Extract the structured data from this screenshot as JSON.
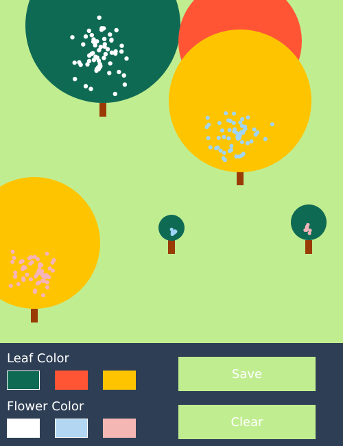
{
  "canvas": {
    "background": "#c1ed91",
    "trunk_color": "#9a3b05"
  },
  "trees": [
    {
      "leaf": "#0f6a54",
      "flower": "#ffffff"
    },
    {
      "leaf": "#ff5535",
      "flower": "#ffffff"
    },
    {
      "leaf": "#ffc400",
      "flower": "#9fd5f6"
    },
    {
      "leaf": "#ffc400",
      "flower": "#f5b3ba"
    },
    {
      "leaf": "#0f6a54",
      "flower": "#9fd5f6"
    },
    {
      "leaf": "#0f6a54",
      "flower": "#f5b3ba"
    }
  ],
  "panel": {
    "background": "#2e3f55",
    "leaf_title": "Leaf Color",
    "flower_title": "Flower Color",
    "leaf_colors": [
      {
        "name": "green",
        "hex": "#0f6a54",
        "selected": true
      },
      {
        "name": "red",
        "hex": "#ff5535",
        "selected": false
      },
      {
        "name": "yellow",
        "hex": "#ffc400",
        "selected": false
      }
    ],
    "flower_colors": [
      {
        "name": "white",
        "hex": "#ffffff",
        "selected": false
      },
      {
        "name": "blue",
        "hex": "#b3d7f2",
        "selected": true
      },
      {
        "name": "pink",
        "hex": "#f5b7b3",
        "selected": false
      }
    ],
    "save_label": "Save",
    "clear_label": "Clear",
    "button_color": "#c1ed91"
  }
}
